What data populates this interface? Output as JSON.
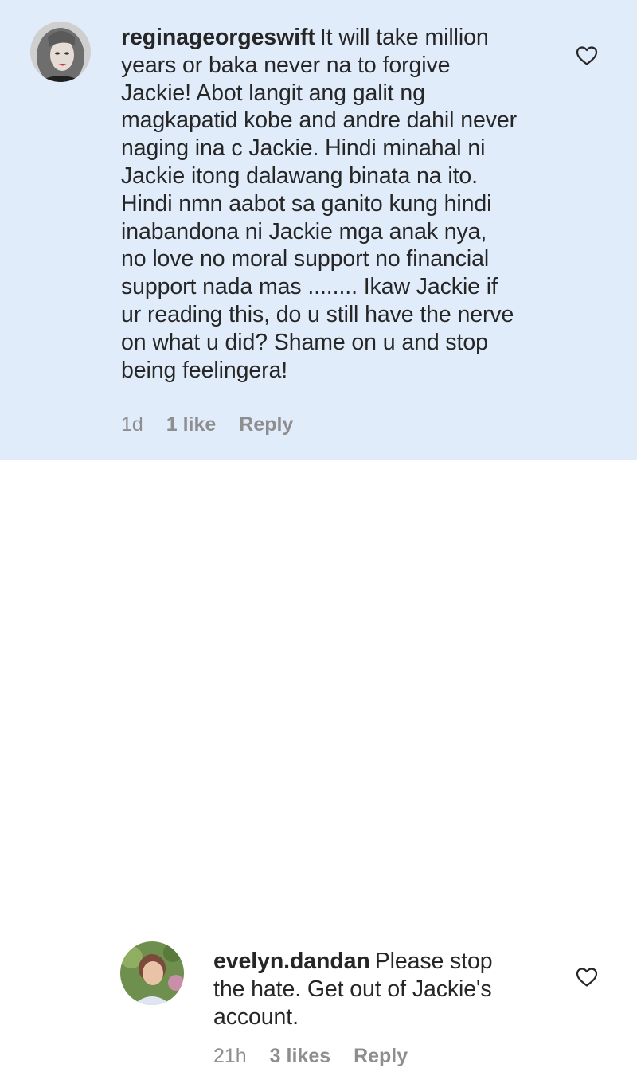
{
  "comments": [
    {
      "username": "reginageorgeswift",
      "lines": [
        "It will take million",
        "years or baka never na to forgive",
        "Jackie! Abot langit ang galit ng",
        "magkapatid kobe and andre dahil never",
        "naging ina c Jackie. Hindi minahal ni",
        "Jackie itong dalawang binata na ito.",
        "Hindi nmn aabot sa ganito kung hindi",
        "inabandona ni Jackie mga anak nya,",
        "no love no moral support no financial",
        "support nada mas ........ Ikaw Jackie if",
        "ur reading this, do u still have the nerve",
        "on what u did? Shame on u and stop",
        "being feelingera!"
      ],
      "time": "1d",
      "likes": "1 like",
      "reply": "Reply",
      "like_icon": "heart-outline-icon"
    },
    {
      "username": "evelyn.dandan",
      "lines": [
        "Please stop",
        "the hate. Get out of Jackie's",
        "account."
      ],
      "time": "21h",
      "likes": "3 likes",
      "reply": "Reply",
      "like_icon": "heart-outline-icon"
    }
  ],
  "colors": {
    "highlight_background": "#e1ecfb",
    "text": "#262626",
    "meta": "#8e8e8e"
  }
}
